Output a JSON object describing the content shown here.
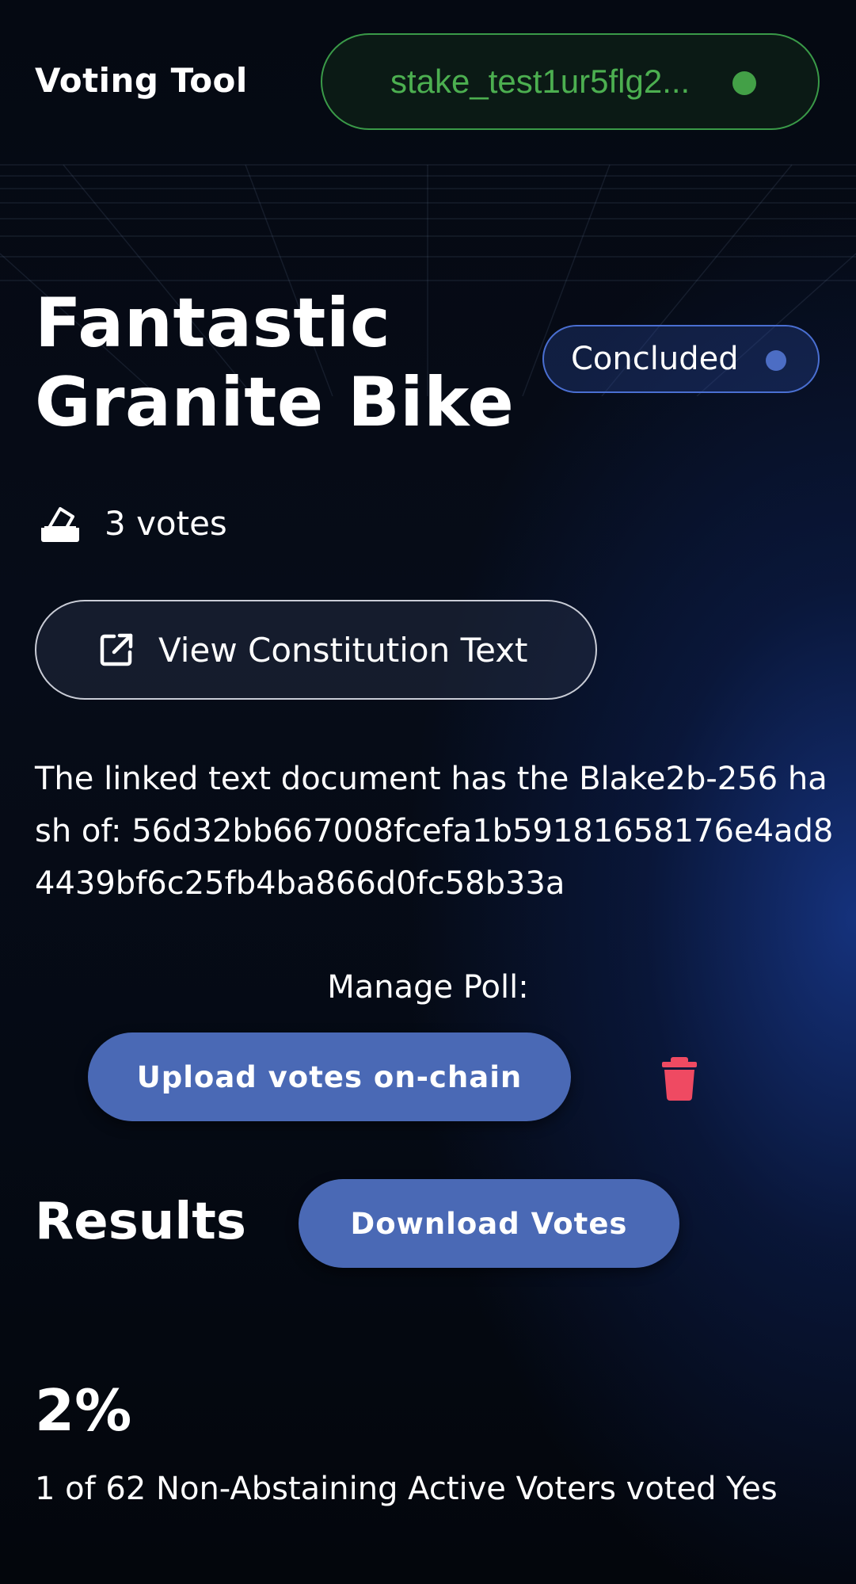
{
  "header": {
    "app_title": "Voting Tool",
    "wallet_address": "stake_test1ur5flg2...",
    "wallet_status_color": "#43a047"
  },
  "poll": {
    "title": "Fantastic Granite Bike",
    "status": "Concluded",
    "status_color": "#4c6dc4",
    "votes_label": "3 votes",
    "votes_icon": "ballot-box-icon",
    "view_button_label": "View Constitution Text",
    "view_button_icon": "external-link-icon",
    "hash_intro": "The linked text document has the Blake2b-256 hash of:",
    "hash_value": "56d32bb667008fcefa1b59181658176e4ad84439bf6c25fb4ba866d0fc58b33a"
  },
  "manage": {
    "label": "Manage Poll:",
    "upload_button_label": "Upload votes on-chain",
    "delete_icon": "trash-icon",
    "delete_color": "#ef4a62"
  },
  "results": {
    "heading": "Results",
    "download_button_label": "Download Votes",
    "percent": "2%",
    "description": "1 of 62 Non-Abstaining Active Voters voted Yes"
  },
  "colors": {
    "accent": "#4a69b5",
    "background": "#040810",
    "wallet_border": "#3a9a48"
  }
}
